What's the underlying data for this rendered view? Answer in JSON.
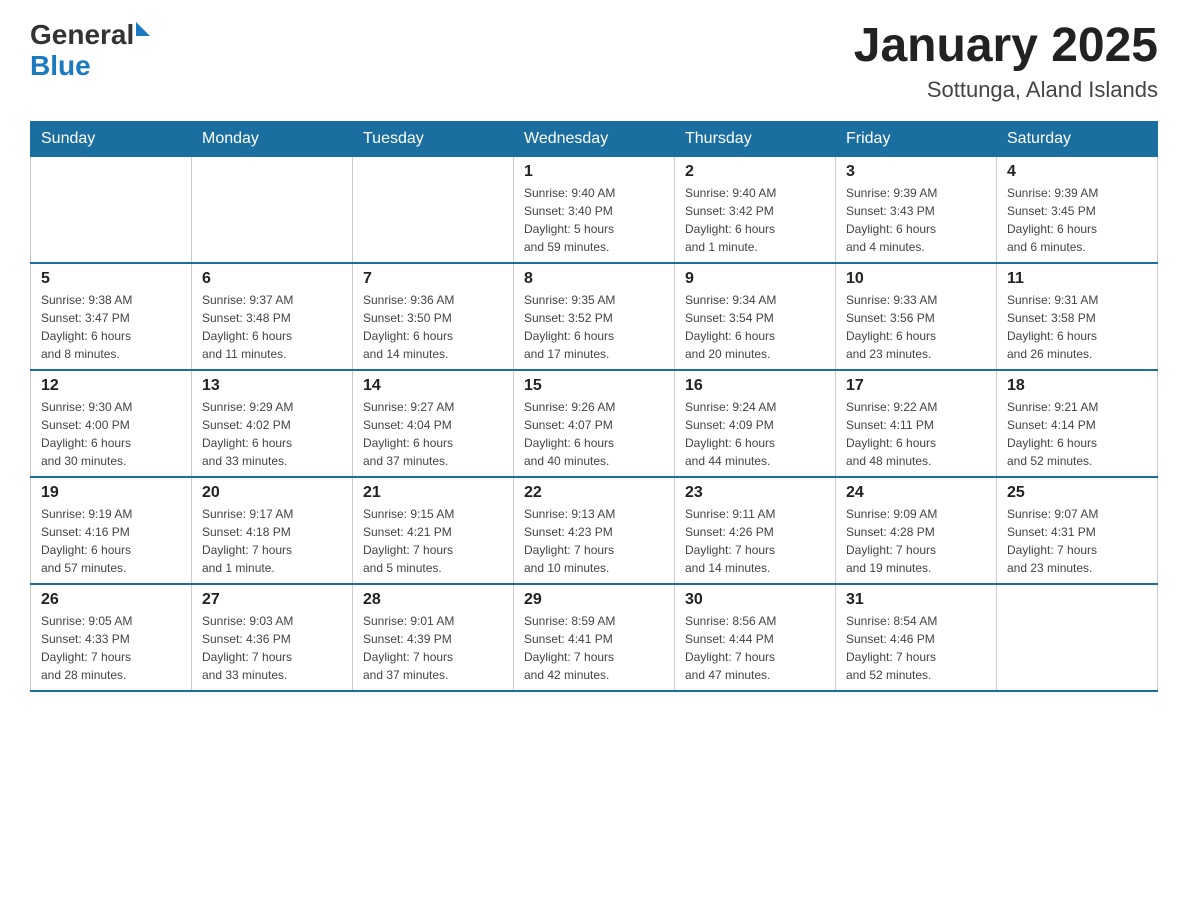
{
  "header": {
    "logo_general": "General",
    "logo_blue": "Blue",
    "month_year": "January 2025",
    "location": "Sottunga, Aland Islands"
  },
  "days_of_week": [
    "Sunday",
    "Monday",
    "Tuesday",
    "Wednesday",
    "Thursday",
    "Friday",
    "Saturday"
  ],
  "weeks": [
    [
      {
        "day": "",
        "info": ""
      },
      {
        "day": "",
        "info": ""
      },
      {
        "day": "",
        "info": ""
      },
      {
        "day": "1",
        "info": "Sunrise: 9:40 AM\nSunset: 3:40 PM\nDaylight: 5 hours\nand 59 minutes."
      },
      {
        "day": "2",
        "info": "Sunrise: 9:40 AM\nSunset: 3:42 PM\nDaylight: 6 hours\nand 1 minute."
      },
      {
        "day": "3",
        "info": "Sunrise: 9:39 AM\nSunset: 3:43 PM\nDaylight: 6 hours\nand 4 minutes."
      },
      {
        "day": "4",
        "info": "Sunrise: 9:39 AM\nSunset: 3:45 PM\nDaylight: 6 hours\nand 6 minutes."
      }
    ],
    [
      {
        "day": "5",
        "info": "Sunrise: 9:38 AM\nSunset: 3:47 PM\nDaylight: 6 hours\nand 8 minutes."
      },
      {
        "day": "6",
        "info": "Sunrise: 9:37 AM\nSunset: 3:48 PM\nDaylight: 6 hours\nand 11 minutes."
      },
      {
        "day": "7",
        "info": "Sunrise: 9:36 AM\nSunset: 3:50 PM\nDaylight: 6 hours\nand 14 minutes."
      },
      {
        "day": "8",
        "info": "Sunrise: 9:35 AM\nSunset: 3:52 PM\nDaylight: 6 hours\nand 17 minutes."
      },
      {
        "day": "9",
        "info": "Sunrise: 9:34 AM\nSunset: 3:54 PM\nDaylight: 6 hours\nand 20 minutes."
      },
      {
        "day": "10",
        "info": "Sunrise: 9:33 AM\nSunset: 3:56 PM\nDaylight: 6 hours\nand 23 minutes."
      },
      {
        "day": "11",
        "info": "Sunrise: 9:31 AM\nSunset: 3:58 PM\nDaylight: 6 hours\nand 26 minutes."
      }
    ],
    [
      {
        "day": "12",
        "info": "Sunrise: 9:30 AM\nSunset: 4:00 PM\nDaylight: 6 hours\nand 30 minutes."
      },
      {
        "day": "13",
        "info": "Sunrise: 9:29 AM\nSunset: 4:02 PM\nDaylight: 6 hours\nand 33 minutes."
      },
      {
        "day": "14",
        "info": "Sunrise: 9:27 AM\nSunset: 4:04 PM\nDaylight: 6 hours\nand 37 minutes."
      },
      {
        "day": "15",
        "info": "Sunrise: 9:26 AM\nSunset: 4:07 PM\nDaylight: 6 hours\nand 40 minutes."
      },
      {
        "day": "16",
        "info": "Sunrise: 9:24 AM\nSunset: 4:09 PM\nDaylight: 6 hours\nand 44 minutes."
      },
      {
        "day": "17",
        "info": "Sunrise: 9:22 AM\nSunset: 4:11 PM\nDaylight: 6 hours\nand 48 minutes."
      },
      {
        "day": "18",
        "info": "Sunrise: 9:21 AM\nSunset: 4:14 PM\nDaylight: 6 hours\nand 52 minutes."
      }
    ],
    [
      {
        "day": "19",
        "info": "Sunrise: 9:19 AM\nSunset: 4:16 PM\nDaylight: 6 hours\nand 57 minutes."
      },
      {
        "day": "20",
        "info": "Sunrise: 9:17 AM\nSunset: 4:18 PM\nDaylight: 7 hours\nand 1 minute."
      },
      {
        "day": "21",
        "info": "Sunrise: 9:15 AM\nSunset: 4:21 PM\nDaylight: 7 hours\nand 5 minutes."
      },
      {
        "day": "22",
        "info": "Sunrise: 9:13 AM\nSunset: 4:23 PM\nDaylight: 7 hours\nand 10 minutes."
      },
      {
        "day": "23",
        "info": "Sunrise: 9:11 AM\nSunset: 4:26 PM\nDaylight: 7 hours\nand 14 minutes."
      },
      {
        "day": "24",
        "info": "Sunrise: 9:09 AM\nSunset: 4:28 PM\nDaylight: 7 hours\nand 19 minutes."
      },
      {
        "day": "25",
        "info": "Sunrise: 9:07 AM\nSunset: 4:31 PM\nDaylight: 7 hours\nand 23 minutes."
      }
    ],
    [
      {
        "day": "26",
        "info": "Sunrise: 9:05 AM\nSunset: 4:33 PM\nDaylight: 7 hours\nand 28 minutes."
      },
      {
        "day": "27",
        "info": "Sunrise: 9:03 AM\nSunset: 4:36 PM\nDaylight: 7 hours\nand 33 minutes."
      },
      {
        "day": "28",
        "info": "Sunrise: 9:01 AM\nSunset: 4:39 PM\nDaylight: 7 hours\nand 37 minutes."
      },
      {
        "day": "29",
        "info": "Sunrise: 8:59 AM\nSunset: 4:41 PM\nDaylight: 7 hours\nand 42 minutes."
      },
      {
        "day": "30",
        "info": "Sunrise: 8:56 AM\nSunset: 4:44 PM\nDaylight: 7 hours\nand 47 minutes."
      },
      {
        "day": "31",
        "info": "Sunrise: 8:54 AM\nSunset: 4:46 PM\nDaylight: 7 hours\nand 52 minutes."
      },
      {
        "day": "",
        "info": ""
      }
    ]
  ]
}
